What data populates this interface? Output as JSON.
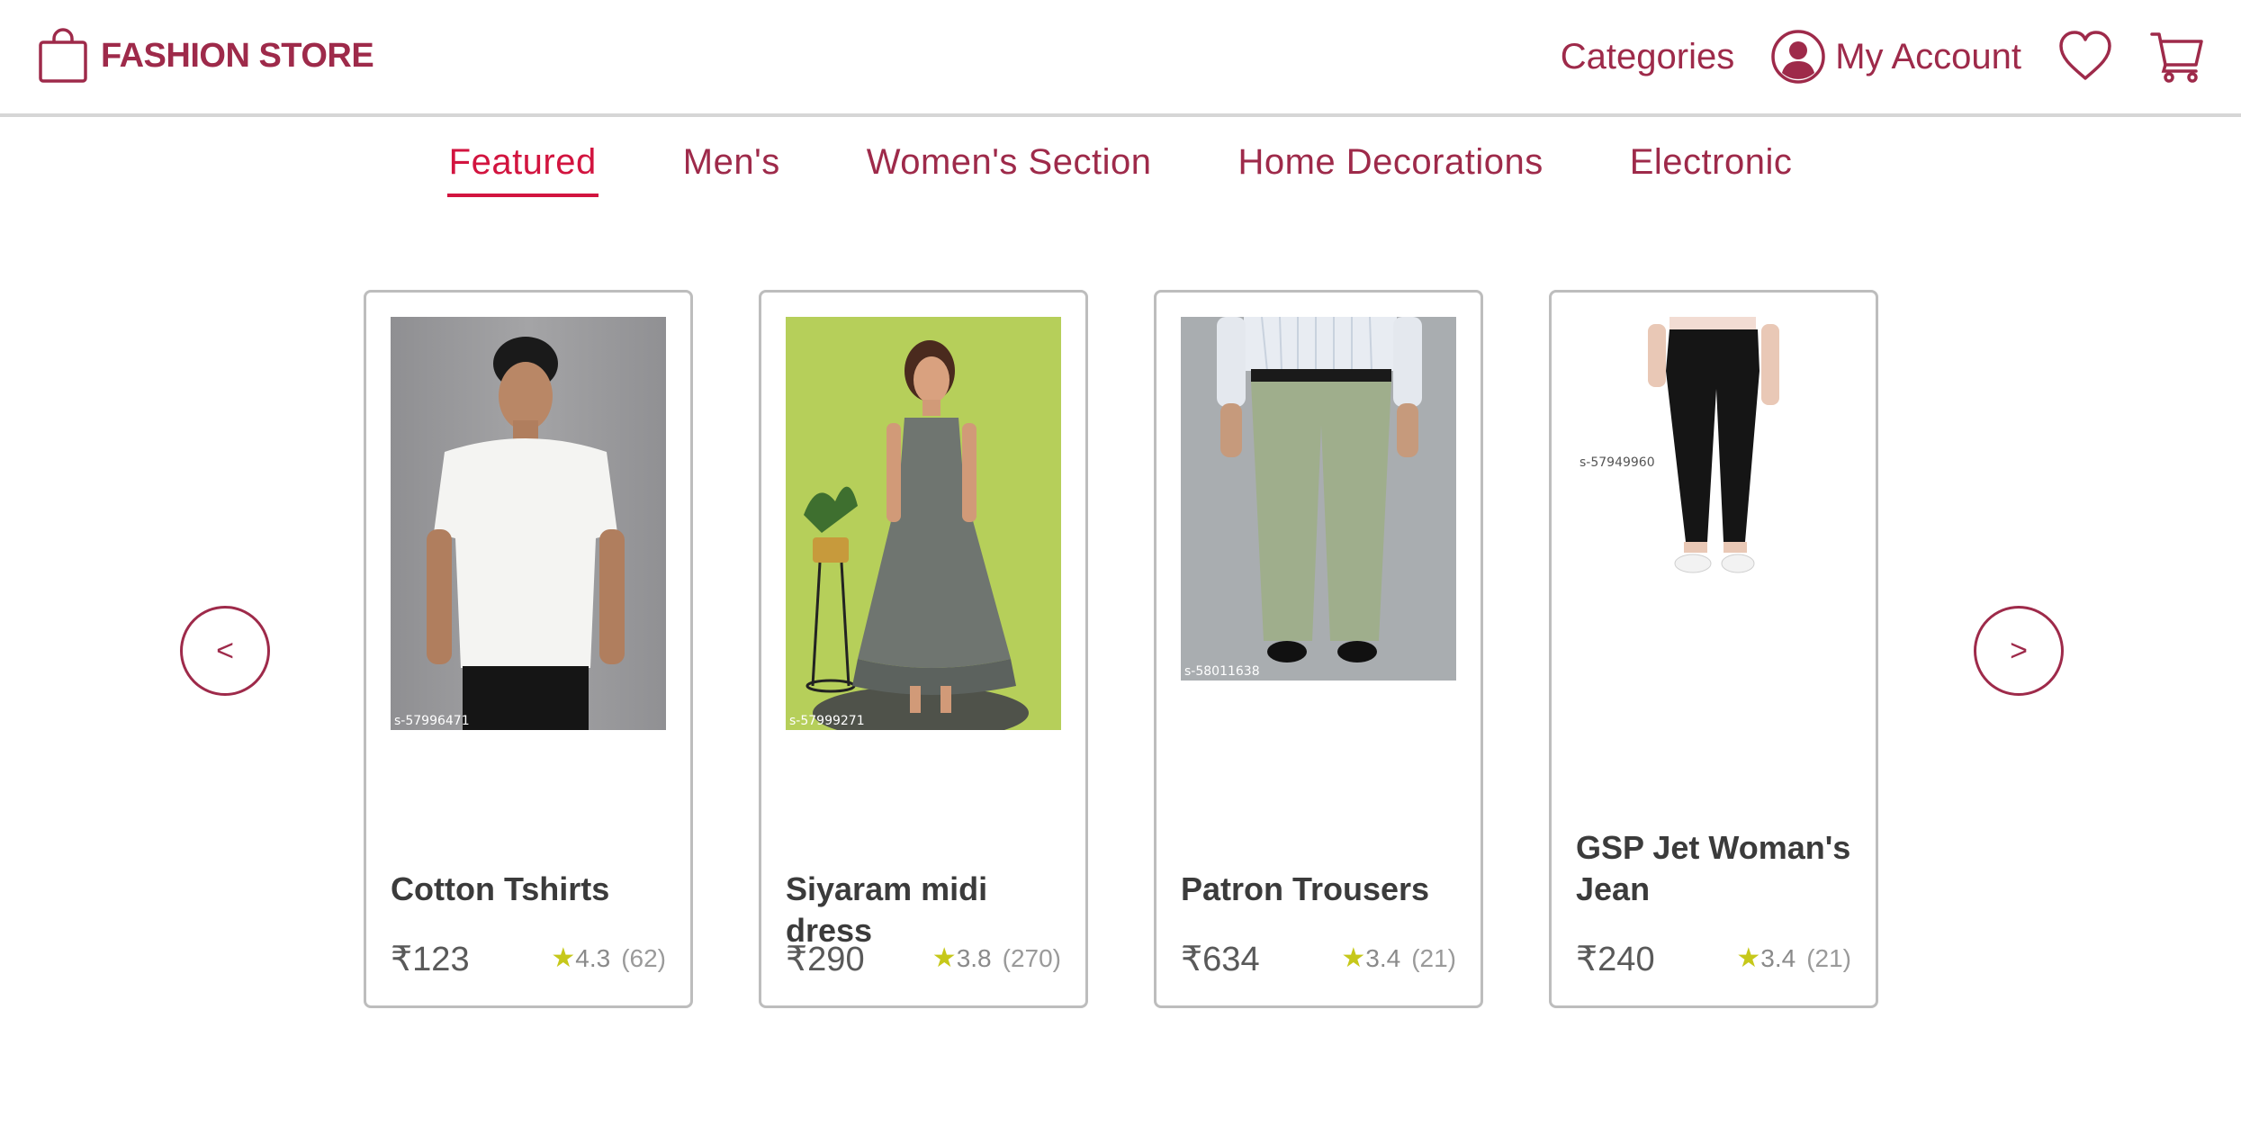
{
  "header": {
    "logo_text": "FASHION STORE",
    "categories_label": "Categories",
    "account_label": "My Account"
  },
  "tabs": [
    {
      "label": "Featured",
      "active": true
    },
    {
      "label": "Men's",
      "active": false
    },
    {
      "label": "Women's Section",
      "active": false
    },
    {
      "label": "Home Decorations",
      "active": false
    },
    {
      "label": "Electronic",
      "active": false
    }
  ],
  "carousel": {
    "prev_label": "<",
    "next_label": ">"
  },
  "products": [
    {
      "title": "Cotton Tshirts",
      "price": "₹123",
      "star": "★",
      "rating": "4.3",
      "reviews": "(62)",
      "sku": "s-57996471"
    },
    {
      "title": "Siyaram midi dress",
      "price": "₹290",
      "star": "★",
      "rating": "3.8",
      "reviews": "(270)",
      "sku": "s-57999271"
    },
    {
      "title": "Patron Trousers",
      "price": "₹634",
      "star": "★",
      "rating": "3.4",
      "reviews": "(21)",
      "sku": "s-58011638"
    },
    {
      "title": "GSP Jet Woman's Jean",
      "price": "₹240",
      "star": "★",
      "rating": "3.4",
      "reviews": "(21)",
      "sku": "s-57949960"
    }
  ],
  "icons": {
    "logo": "shopping-bag-icon",
    "account": "user-circle-icon",
    "wishlist": "heart-icon",
    "cart": "cart-icon"
  },
  "colors": {
    "brand": "#9e2a4a",
    "active_tab": "#d2143f",
    "star": "#c6c81a",
    "card_border": "#bdbdbd"
  }
}
